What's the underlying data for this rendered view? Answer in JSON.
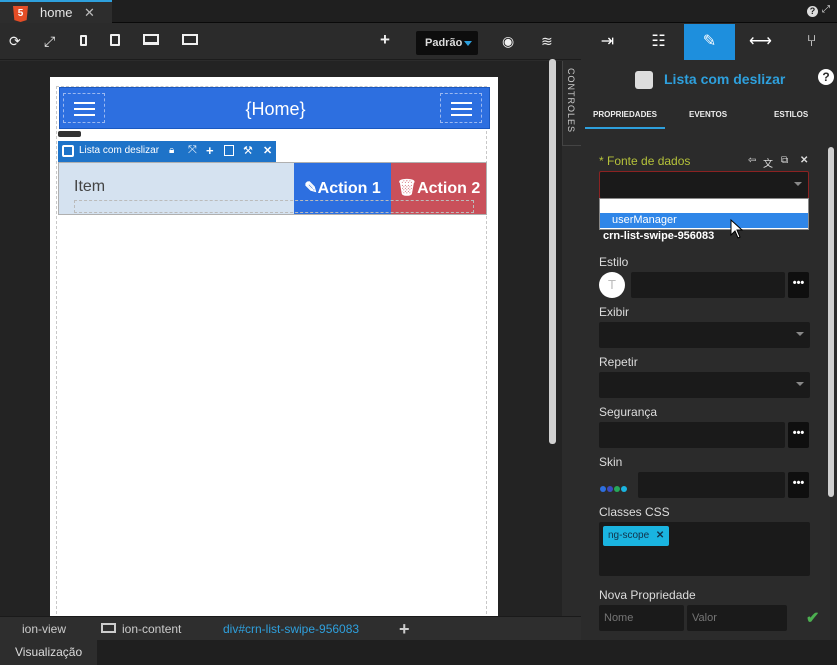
{
  "tabbar": {
    "tab_label": "home",
    "html5_badge": "5",
    "close_glyph": "✕",
    "help_glyph": "?",
    "restore_glyph": "⤢"
  },
  "toolbar": {
    "preset_label": "Padrão",
    "icons": [
      "refresh-icon",
      "fullscreen-icon",
      "mobile-icon",
      "tablet-icon",
      "desktop-icon",
      "monitor-icon",
      "add-icon",
      "preview-icon",
      "data-icon"
    ]
  },
  "canvas": {
    "header_title": "{Home}",
    "selection_label": "Lista com deslizar",
    "item_label": "Item",
    "action1_label": "Action 1",
    "action2_label": "Action 2",
    "action1_icon": "pencil-icon",
    "action2_icon": "trash-icon",
    "colors": {
      "header": "#2d6fe0",
      "action1": "#2d6fe0",
      "action2": "#c9505a",
      "item_bg": "#d5e2f0"
    }
  },
  "controls_strip": {
    "label": "CONTROLES"
  },
  "panel": {
    "title": "Lista com deslizar",
    "tabs": [
      "PROPRIEDADES",
      "EVENTOS",
      "ESTILOS"
    ],
    "active_tab": "PROPRIEDADES",
    "fonte_label": "* Fonte de dados",
    "dropdown_option": "userManager",
    "component_id": "crn-list-swipe-956083",
    "estilo_label": "Estilo",
    "estilo_initial": "T",
    "exibir_label": "Exibir",
    "repetir_label": "Repetir",
    "seguranca_label": "Segurança",
    "skin_label": "Skin",
    "classes_label": "Classes CSS",
    "class_chip": "ng-scope",
    "nova_label": "Nova Propriedade",
    "nome_placeholder": "Nome",
    "valor_placeholder": "Valor",
    "dots": "•••",
    "accent": "#2ea0dd",
    "skin_colors": [
      "#2d6fe0",
      "#3b4cc0",
      "#27a85b",
      "#1ab4e0"
    ]
  },
  "breadcrumb": {
    "items": [
      "ion-view",
      "ion-content",
      "div#crn-list-swipe-956083"
    ],
    "active": "div#crn-list-swipe-956083"
  },
  "status": {
    "tab_label": "Visualização"
  }
}
